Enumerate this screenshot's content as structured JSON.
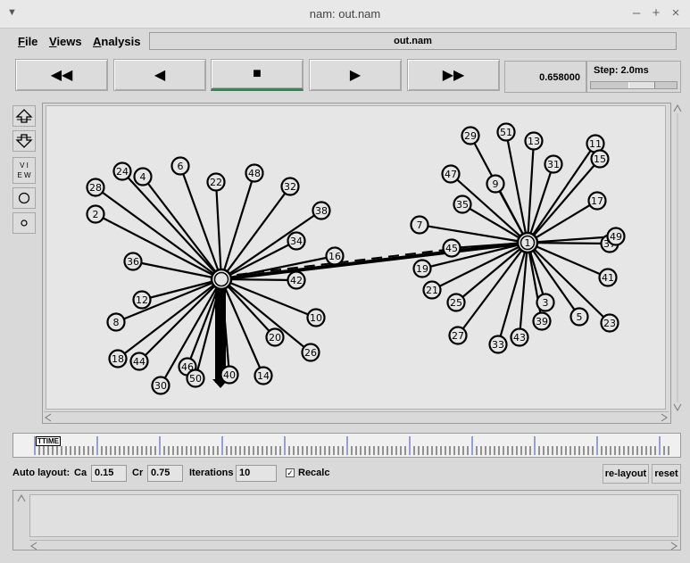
{
  "window": {
    "title": "nam: out.nam"
  },
  "menu": {
    "file": "File",
    "views": "Views",
    "analysis": "Analysis",
    "filename": "out.nam"
  },
  "transport": {
    "current_time": "0.658000",
    "step_label": "Step: 2.0ms"
  },
  "left_tools": {
    "view_label": "V I E W"
  },
  "timeline": {
    "marker": "TTIME"
  },
  "autolayout": {
    "label": "Auto layout:",
    "ca_label": "Ca",
    "ca_value": "0.15",
    "cr_label": "Cr",
    "cr_value": "0.75",
    "iter_label": "Iterations",
    "iter_value": "10",
    "recalc_label": "Recalc",
    "recalc_checked": true,
    "relayout_label": "re-layout",
    "reset_label": "reset"
  },
  "topology": {
    "hubs": [
      {
        "id": "0",
        "label": ""
      },
      {
        "id": "1",
        "label": "1"
      }
    ],
    "nodes": [
      {
        "label": "28",
        "hub": "0"
      },
      {
        "label": "24",
        "hub": "0"
      },
      {
        "label": "4",
        "hub": "0"
      },
      {
        "label": "6",
        "hub": "0"
      },
      {
        "label": "22",
        "hub": "0"
      },
      {
        "label": "48",
        "hub": "0"
      },
      {
        "label": "32",
        "hub": "0"
      },
      {
        "label": "2",
        "hub": "0"
      },
      {
        "label": "38",
        "hub": "0"
      },
      {
        "label": "34",
        "hub": "0"
      },
      {
        "label": "36",
        "hub": "0"
      },
      {
        "label": "16",
        "hub": "0"
      },
      {
        "label": "42",
        "hub": "0"
      },
      {
        "label": "12",
        "hub": "0"
      },
      {
        "label": "8",
        "hub": "0"
      },
      {
        "label": "10",
        "hub": "0"
      },
      {
        "label": "20",
        "hub": "0"
      },
      {
        "label": "26",
        "hub": "0"
      },
      {
        "label": "18",
        "hub": "0"
      },
      {
        "label": "44",
        "hub": "0"
      },
      {
        "label": "46",
        "hub": "0"
      },
      {
        "label": "50",
        "hub": "0"
      },
      {
        "label": "40",
        "hub": "0"
      },
      {
        "label": "14",
        "hub": "0"
      },
      {
        "label": "30",
        "hub": "0"
      },
      {
        "label": "29",
        "hub": "1"
      },
      {
        "label": "51",
        "hub": "1"
      },
      {
        "label": "13",
        "hub": "1"
      },
      {
        "label": "11",
        "hub": "1"
      },
      {
        "label": "15",
        "hub": "1"
      },
      {
        "label": "47",
        "hub": "1"
      },
      {
        "label": "31",
        "hub": "1"
      },
      {
        "label": "9",
        "hub": "1"
      },
      {
        "label": "35",
        "hub": "1"
      },
      {
        "label": "17",
        "hub": "1"
      },
      {
        "label": "7",
        "hub": "1"
      },
      {
        "label": "45",
        "hub": "1"
      },
      {
        "label": "37",
        "hub": "1"
      },
      {
        "label": "49",
        "hub": "1"
      },
      {
        "label": "19",
        "hub": "1"
      },
      {
        "label": "41",
        "hub": "1"
      },
      {
        "label": "21",
        "hub": "1"
      },
      {
        "label": "25",
        "hub": "1"
      },
      {
        "label": "3",
        "hub": "1"
      },
      {
        "label": "5",
        "hub": "1"
      },
      {
        "label": "39",
        "hub": "1"
      },
      {
        "label": "23",
        "hub": "1"
      },
      {
        "label": "27",
        "hub": "1"
      },
      {
        "label": "33",
        "hub": "1"
      },
      {
        "label": "43",
        "hub": "1"
      }
    ]
  }
}
